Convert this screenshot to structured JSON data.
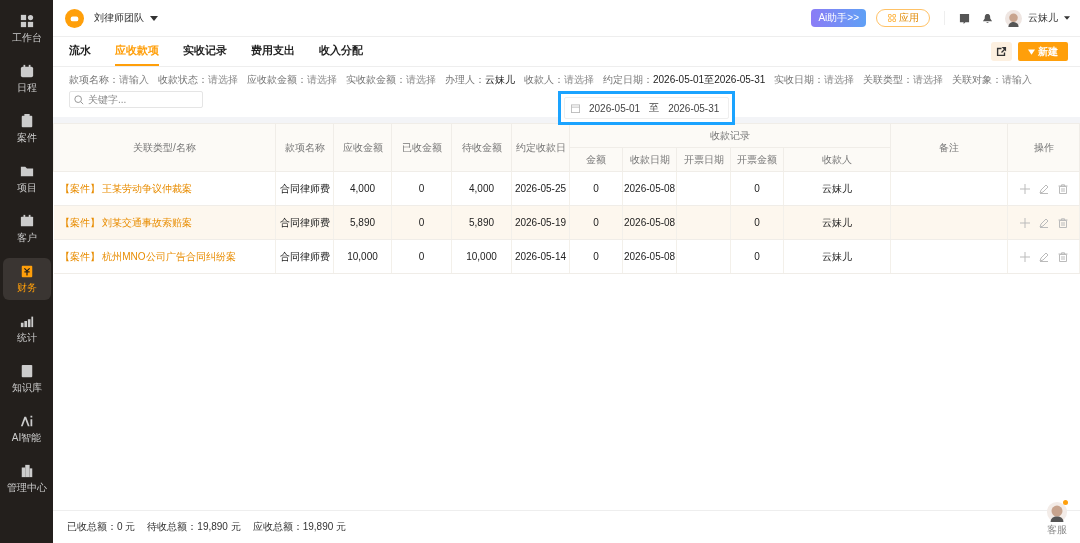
{
  "sidebar": {
    "items": [
      {
        "label": "工作台",
        "selected": false
      },
      {
        "label": "日程",
        "selected": false
      },
      {
        "label": "案件",
        "selected": false
      },
      {
        "label": "项目",
        "selected": false
      },
      {
        "label": "客户",
        "selected": false
      },
      {
        "label": "财务",
        "selected": true
      },
      {
        "label": "统计",
        "selected": false
      },
      {
        "label": "知识库",
        "selected": false
      },
      {
        "label": "AI智能",
        "selected": false
      },
      {
        "label": "管理中心",
        "selected": false
      }
    ]
  },
  "header": {
    "team": "刘律师团队",
    "ai_button": "Ai助手>>",
    "apps_button": "应用",
    "user": "云妹儿"
  },
  "tabs": [
    {
      "label": "流水",
      "selected": false
    },
    {
      "label": "应收款项",
      "selected": true
    },
    {
      "label": "实收记录",
      "selected": false
    },
    {
      "label": "费用支出",
      "selected": false
    },
    {
      "label": "收入分配",
      "selected": false
    }
  ],
  "new_button": "新建",
  "filters": [
    {
      "label": "款项名称：",
      "placeholder": "请输入"
    },
    {
      "label": "收款状态：",
      "placeholder": "请选择"
    },
    {
      "label": "应收款金额：",
      "placeholder": "请选择"
    },
    {
      "label": "实收款金额：",
      "placeholder": "请选择"
    },
    {
      "label": "办理人：",
      "value": "云妹儿"
    },
    {
      "label": "收款人：",
      "placeholder": "请选择"
    },
    {
      "label": "约定日期：",
      "value": "2026-05-01至2026-05-31"
    },
    {
      "label": "实收日期：",
      "placeholder": "请选择"
    },
    {
      "label": "关联类型：",
      "placeholder": "请选择"
    },
    {
      "label": "关联对象：",
      "placeholder": "请输入"
    }
  ],
  "search": {
    "placeholder": "关键字..."
  },
  "date_popup": {
    "start": "2026-05-01",
    "separator": "至",
    "end": "2026-05-31"
  },
  "table": {
    "columns": [
      "关联类型/名称",
      "款项名称",
      "应收金额",
      "已收金额",
      "待收金额",
      "约定收款日"
    ],
    "group": "收款记录",
    "sub_columns": [
      "金额",
      "收款日期",
      "开票日期",
      "开票金额",
      "收款人"
    ],
    "tail_columns": [
      "备注",
      "操作"
    ],
    "rows": [
      {
        "type": "【案件】",
        "name": "王某劳动争议仲裁案",
        "item": "合同律师费",
        "due": "4,000",
        "received": "0",
        "pending": "4,000",
        "date": "2026-05-25",
        "amount": "0",
        "pay_date": "2026-05-08",
        "invoice_amount": "0",
        "payee": "云妹儿",
        "highlighted": false
      },
      {
        "type": "【案件】",
        "name": "刘某交通事故索赔案",
        "item": "合同律师费",
        "due": "5,890",
        "received": "0",
        "pending": "5,890",
        "date": "2026-05-19",
        "amount": "0",
        "pay_date": "2026-05-08",
        "invoice_amount": "0",
        "payee": "云妹儿",
        "highlighted": true
      },
      {
        "type": "【案件】",
        "name": "杭州MNO公司广告合同纠纷案",
        "item": "合同律师费",
        "due": "10,000",
        "received": "0",
        "pending": "10,000",
        "date": "2026-05-14",
        "amount": "0",
        "pay_date": "2026-05-08",
        "invoice_amount": "0",
        "payee": "云妹儿",
        "highlighted": false
      }
    ]
  },
  "footer": [
    {
      "label": "已收总额：",
      "value": "0 元"
    },
    {
      "label": "待收总额：",
      "value": "19,890 元"
    },
    {
      "label": "应收总额：",
      "value": "19,890 元"
    }
  ],
  "support": {
    "label": "客服"
  }
}
